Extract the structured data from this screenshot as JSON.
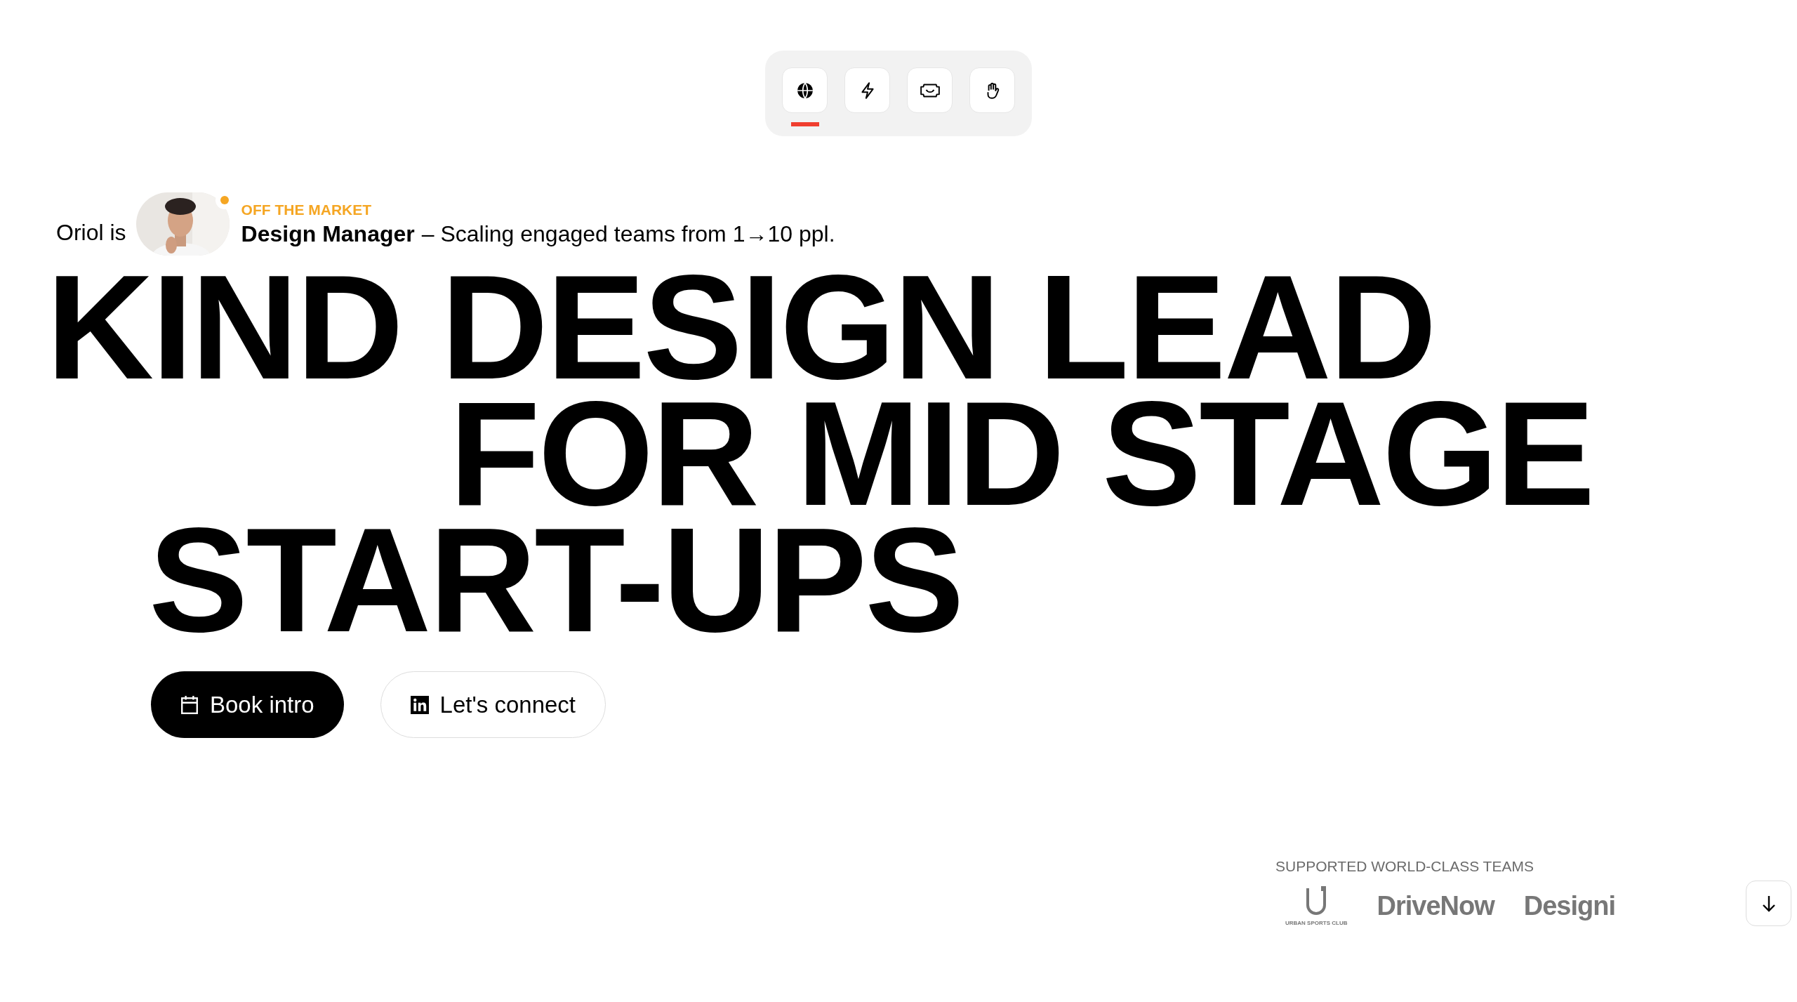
{
  "nav": {
    "items": [
      {
        "kind": "globe",
        "selected": true
      },
      {
        "kind": "bolt",
        "selected": false
      },
      {
        "kind": "ticket",
        "selected": false
      },
      {
        "kind": "hand",
        "selected": false
      }
    ]
  },
  "intro": {
    "lead": "Oriol is",
    "status": "OFF THE MARKET",
    "role": "Design Manager",
    "tagline": "– Scaling engaged teams from 1→10 ppl."
  },
  "headline": [
    "KIND DESIGN LEAD",
    "FOR MID STAGE",
    "START-UPS"
  ],
  "buttons": [
    {
      "kind": "primary",
      "label": "Book intro"
    },
    {
      "kind": "secondary",
      "label": "Let's connect"
    }
  ],
  "teams": {
    "title": "SUPPORTED WORLD-CLASS TEAMS",
    "logos": [
      {
        "kind": "emblem",
        "text": "URBAN SPORTS CLUB"
      },
      {
        "kind": "wordmark",
        "text": "DriveNow"
      },
      {
        "kind": "wordmark",
        "text": "Designi"
      }
    ]
  },
  "scroll_button": {
    "kind": "down"
  }
}
